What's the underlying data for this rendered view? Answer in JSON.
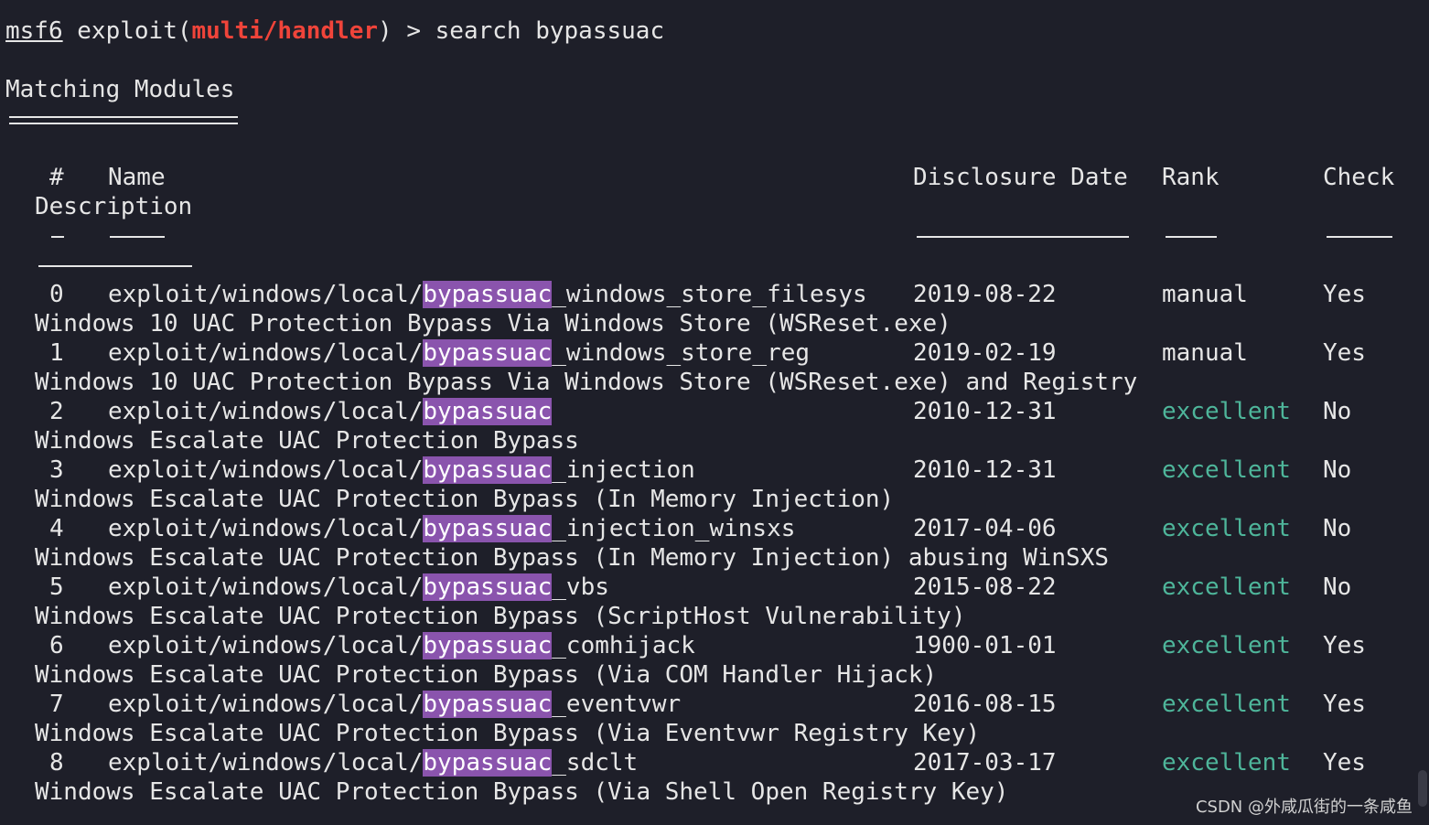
{
  "prompt": {
    "app": "msf6",
    "pre": " exploit(",
    "module": "multi/handler",
    "post": ") > ",
    "command": "search bypassuac"
  },
  "heading": "Matching Modules",
  "columns": {
    "num": "#",
    "name": "Name",
    "date": "Disclosure Date",
    "rank": "Rank",
    "check": "Check",
    "desc": "Description"
  },
  "colors": {
    "background": "#1e1f29",
    "highlight": "#8a54ad",
    "rank_excellent": "#4eb59a",
    "module_red": "#f0443a"
  },
  "modules": [
    {
      "num": "0",
      "prefix": "exploit/windows/local/",
      "match": "bypassuac",
      "suffix": "_windows_store_filesys",
      "date": "2019-08-22",
      "rank": "manual",
      "check": "Yes",
      "desc": "Windows 10 UAC Protection Bypass Via Windows Store (WSReset.exe)"
    },
    {
      "num": "1",
      "prefix": "exploit/windows/local/",
      "match": "bypassuac",
      "suffix": "_windows_store_reg",
      "date": "2019-02-19",
      "rank": "manual",
      "check": "Yes",
      "desc": "Windows 10 UAC Protection Bypass Via Windows Store (WSReset.exe) and Registry"
    },
    {
      "num": "2",
      "prefix": "exploit/windows/local/",
      "match": "bypassuac",
      "suffix": "",
      "date": "2010-12-31",
      "rank": "excellent",
      "check": "No",
      "desc": "Windows Escalate UAC Protection Bypass"
    },
    {
      "num": "3",
      "prefix": "exploit/windows/local/",
      "match": "bypassuac",
      "suffix": "_injection",
      "date": "2010-12-31",
      "rank": "excellent",
      "check": "No",
      "desc": "Windows Escalate UAC Protection Bypass (In Memory Injection)"
    },
    {
      "num": "4",
      "prefix": "exploit/windows/local/",
      "match": "bypassuac",
      "suffix": "_injection_winsxs",
      "date": "2017-04-06",
      "rank": "excellent",
      "check": "No",
      "desc": "Windows Escalate UAC Protection Bypass (In Memory Injection) abusing WinSXS"
    },
    {
      "num": "5",
      "prefix": "exploit/windows/local/",
      "match": "bypassuac",
      "suffix": "_vbs",
      "date": "2015-08-22",
      "rank": "excellent",
      "check": "No",
      "desc": "Windows Escalate UAC Protection Bypass (ScriptHost Vulnerability)"
    },
    {
      "num": "6",
      "prefix": "exploit/windows/local/",
      "match": "bypassuac",
      "suffix": "_comhijack",
      "date": "1900-01-01",
      "rank": "excellent",
      "check": "Yes",
      "desc": "Windows Escalate UAC Protection Bypass (Via COM Handler Hijack)"
    },
    {
      "num": "7",
      "prefix": "exploit/windows/local/",
      "match": "bypassuac",
      "suffix": "_eventvwr",
      "date": "2016-08-15",
      "rank": "excellent",
      "check": "Yes",
      "desc": "Windows Escalate UAC Protection Bypass (Via Eventvwr Registry Key)"
    },
    {
      "num": "8",
      "prefix": "exploit/windows/local/",
      "match": "bypassuac",
      "suffix": "_sdclt",
      "date": "2017-03-17",
      "rank": "excellent",
      "check": "Yes",
      "desc": "Windows Escalate UAC Protection Bypass (Via Shell Open Registry Key)"
    }
  ],
  "watermark": "CSDN @外咸瓜街的一条咸鱼"
}
